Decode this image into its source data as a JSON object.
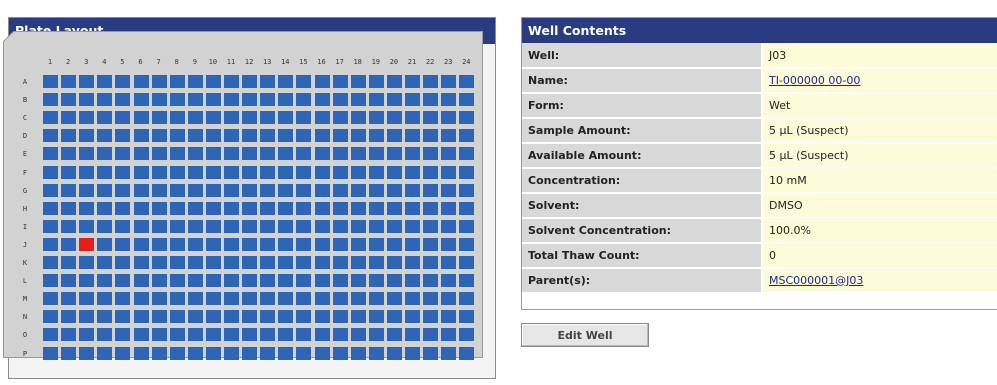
{
  "plate_panel": {
    "title": "Plate Layout",
    "columns": [
      "1",
      "2",
      "3",
      "4",
      "5",
      "6",
      "7",
      "8",
      "9",
      "10",
      "11",
      "12",
      "13",
      "14",
      "15",
      "16",
      "17",
      "18",
      "19",
      "20",
      "21",
      "22",
      "23",
      "24"
    ],
    "rows": [
      "A",
      "B",
      "C",
      "D",
      "E",
      "F",
      "G",
      "H",
      "I",
      "J",
      "K",
      "L",
      "M",
      "N",
      "O",
      "P"
    ],
    "selected_well": {
      "row": "J",
      "column": "3"
    },
    "colors": {
      "well": "#2e66b5",
      "selected_well": "#e41e1e",
      "header": "#2a3b82"
    }
  },
  "contents_panel": {
    "title": "Well Contents",
    "properties": [
      {
        "key": "Well:",
        "value": "J03",
        "link": false
      },
      {
        "key": "Name:",
        "value": "TI-000000 00-00",
        "link": true
      },
      {
        "key": "Form:",
        "value": "Wet",
        "link": false
      },
      {
        "key": "Sample Amount:",
        "value": "5 µL (Suspect)",
        "link": false
      },
      {
        "key": "Available Amount:",
        "value": "5 µL (Suspect)",
        "link": false
      },
      {
        "key": "Concentration:",
        "value": "10 mM",
        "link": false
      },
      {
        "key": "Solvent:",
        "value": "DMSO",
        "link": false
      },
      {
        "key": "Solvent Concentration:",
        "value": "100.0%",
        "link": false
      },
      {
        "key": "Total Thaw Count:",
        "value": "0",
        "link": false
      },
      {
        "key": "Parent(s):",
        "value": "MSC000001@J03",
        "link": true
      }
    ]
  },
  "edit_button": {
    "label": "Edit Well"
  }
}
